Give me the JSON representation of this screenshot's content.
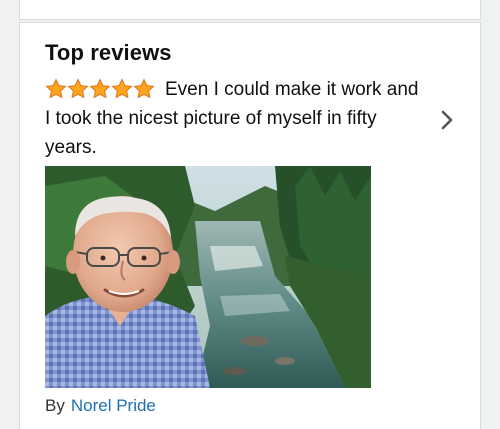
{
  "section": {
    "title": "Top reviews"
  },
  "review": {
    "rating": 5,
    "rating_max": 5,
    "text": "Even I could make it work and I took the nicest picture of myself in fifty years.",
    "by_label": "By",
    "author": "Norel Pride",
    "photo_icon": "review-photo-image"
  },
  "colors": {
    "star_fill": "#ffa41c",
    "star_stroke": "#de7921",
    "link": "#1e6fb3",
    "chevron": "#555555"
  }
}
